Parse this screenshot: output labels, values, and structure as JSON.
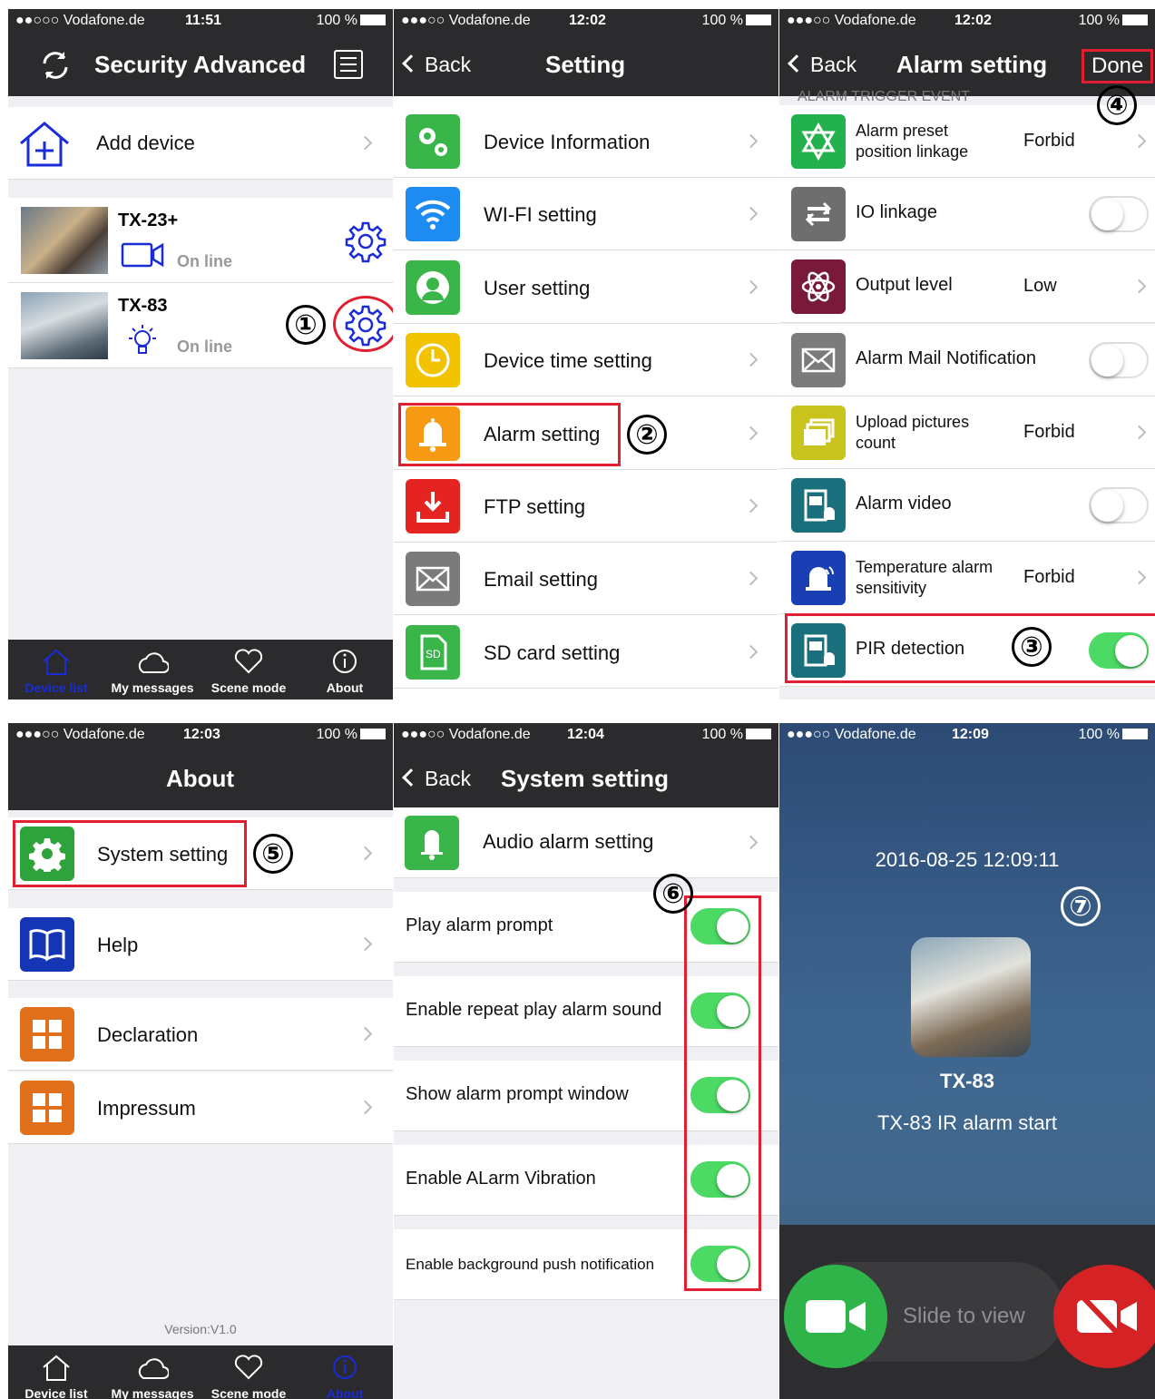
{
  "colors": {
    "navbar": "#2b2b2d",
    "accent_blue": "#1a2bd8",
    "toggle_on": "#4cd964",
    "annotation_red": "#e02030"
  },
  "status_bars": [
    {
      "carrier": "●●○○○ Vodafone.de",
      "time": "11:51",
      "battery": "100 %"
    },
    {
      "carrier": "●●●○○ Vodafone.de",
      "time": "12:02",
      "battery": "100 %"
    },
    {
      "carrier": "●●●○○ Vodafone.de",
      "time": "12:02",
      "battery": "100 %"
    },
    {
      "carrier": "●●●○○ Vodafone.de",
      "time": "12:03",
      "battery": "100 %"
    },
    {
      "carrier": "●●●○○ Vodafone.de",
      "time": "12:04",
      "battery": "100 %"
    },
    {
      "carrier": "●●●○○ Vodafone.de",
      "time": "12:09",
      "battery": "100 %"
    }
  ],
  "step_numbers": [
    "①",
    "②",
    "③",
    "④",
    "⑤",
    "⑥",
    "⑦"
  ],
  "screen1": {
    "title": "Security Advanced",
    "add_device": "Add device",
    "devices": [
      {
        "name": "TX-23+",
        "status": "On line"
      },
      {
        "name": "TX-83",
        "status": "On line"
      }
    ]
  },
  "tabbar": {
    "items": [
      "Device list",
      "My messages",
      "Scene mode",
      "About"
    ]
  },
  "screen2": {
    "back": "Back",
    "title": "Setting",
    "items": [
      "Device Information",
      "WI-FI setting",
      "User setting",
      "Device time setting",
      "Alarm setting",
      "FTP setting",
      "Email setting",
      "SD card setting"
    ]
  },
  "screen3": {
    "back": "Back",
    "title": "Alarm setting",
    "done": "Done",
    "section": "ALARM TRIGGER EVENT",
    "items": [
      {
        "label": "Alarm preset position linkage",
        "value": "Forbid"
      },
      {
        "label": "IO linkage",
        "toggle": false
      },
      {
        "label": "Output level",
        "value": "Low"
      },
      {
        "label": "Alarm Mail Notification",
        "toggle": false
      },
      {
        "label": "Upload pictures count",
        "value": "Forbid"
      },
      {
        "label": "Alarm video",
        "toggle": false
      },
      {
        "label": "Temperature alarm sensitivity",
        "value": "Forbid"
      },
      {
        "label": "PIR detection",
        "toggle": true
      }
    ]
  },
  "screen4": {
    "title": "About",
    "items": [
      "System setting",
      "Help",
      "Declaration",
      "Impressum"
    ],
    "version": "Version:V1.0"
  },
  "screen5": {
    "back": "Back",
    "title": "System setting",
    "audio": "Audio alarm setting",
    "toggles": [
      {
        "label": "Play alarm prompt",
        "on": true
      },
      {
        "label": "Enable repeat play alarm sound",
        "on": true
      },
      {
        "label": "Show alarm prompt window",
        "on": true
      },
      {
        "label": "Enable ALarm Vibration",
        "on": true
      },
      {
        "label": "Enable background push notification",
        "on": true
      }
    ]
  },
  "screen6": {
    "datetime": "2016-08-25 12:09:11",
    "device": "TX-83",
    "message": "TX-83 IR alarm start",
    "slide": "Slide to view"
  }
}
